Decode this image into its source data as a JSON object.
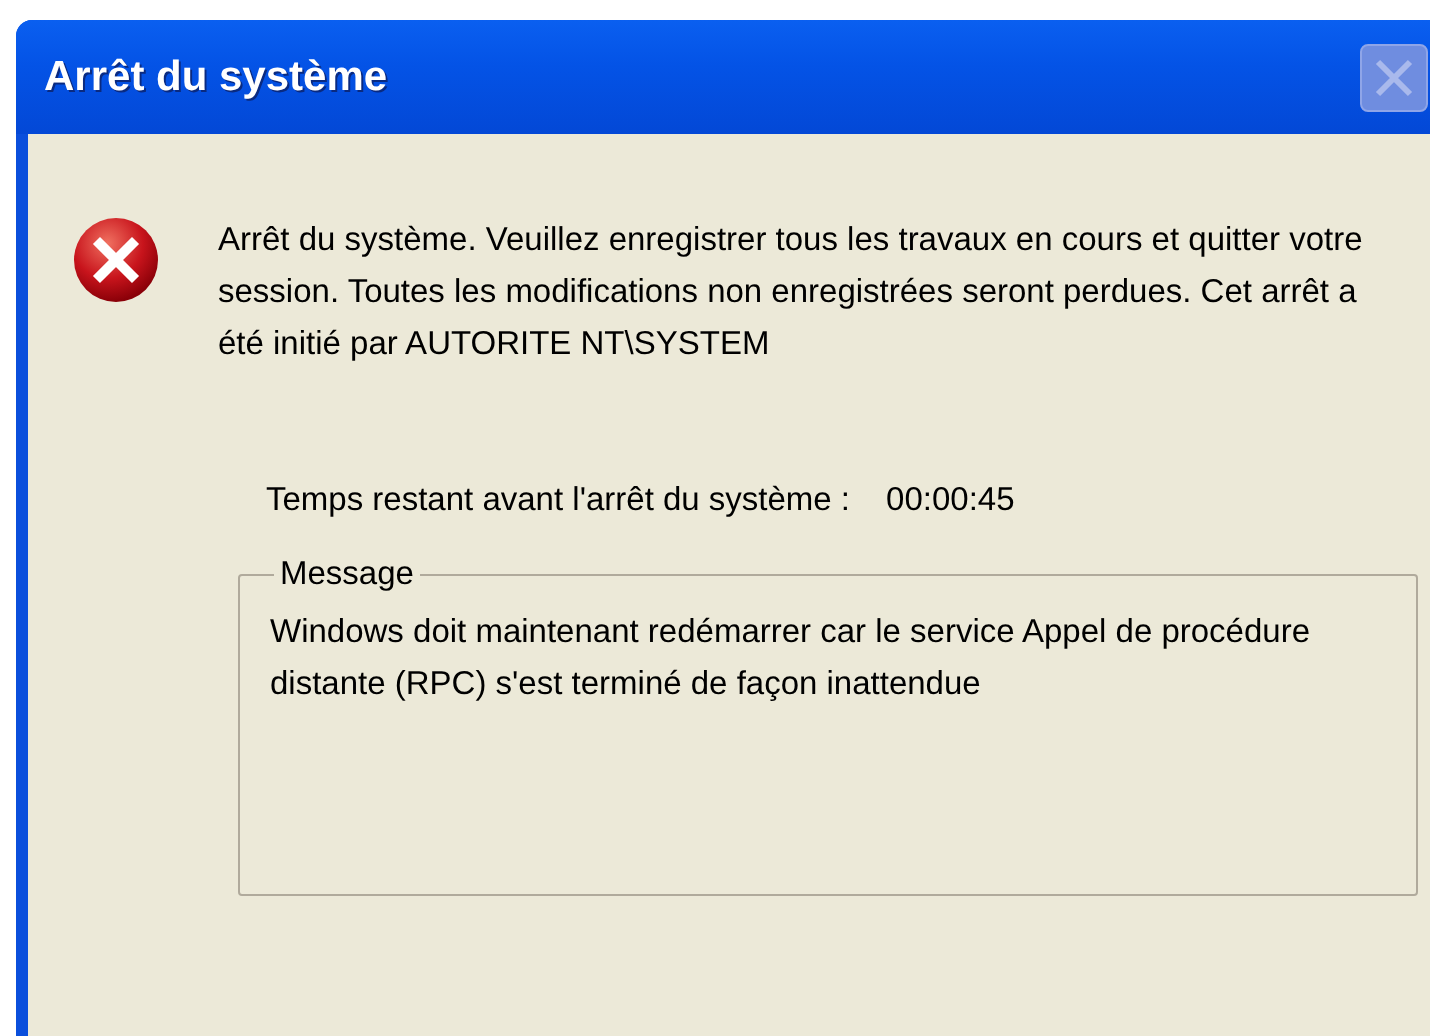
{
  "window": {
    "title": "Arrêt du système",
    "close_button": {
      "disabled": true
    }
  },
  "message": {
    "kind": "error",
    "text": "Arrêt du système. Veuillez enregistrer tous les travaux en cours et quitter votre session. Toutes les modifications non enregistrées seront perdues. Cet arrêt a été initié par AUTORITE NT\\SYSTEM"
  },
  "countdown": {
    "label": "Temps restant avant l'arrêt du système :",
    "value": "00:00:45"
  },
  "message_group": {
    "title": "Message",
    "text": "Windows doit maintenant redémarrer car le service Appel de procédure distante (RPC) s'est terminé de façon inattendue"
  }
}
